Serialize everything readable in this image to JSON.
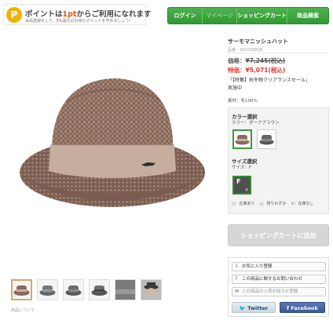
{
  "promo": {
    "badge": "P",
    "main_prefix": "ポイントは",
    "main_highlight": "1pt",
    "main_suffix": "からご利用になれます",
    "sub_prefix": "会員登録をして、",
    "sub_highlight": "5%",
    "sub_suffix": "還元のお得なポイントを貯めましょう！"
  },
  "nav": {
    "items": [
      {
        "label": "ログイン",
        "dim": false
      },
      {
        "label": "マイページ",
        "dim": true
      },
      {
        "label": "ショッピングカート",
        "dim": false
      },
      {
        "label": "商品検索",
        "dim": false
      }
    ]
  },
  "product": {
    "title": "サーモマニッシュハット",
    "code": "品番：161025818",
    "price_label": "価格：",
    "price_value": "¥7,245(税込)",
    "sale_label": "特価：",
    "sale_value": "¥5,071(税込)",
    "campaign_line1": "「【特集】秋冬物クリアランスセール」",
    "campaign_line2": "実施中",
    "material": "素材：毛100%"
  },
  "selection": {
    "color_heading": "カラー選択",
    "color_current": "カラー：ダークブラウン",
    "size_heading": "サイズ選択",
    "size_current": "サイズ：F",
    "size_option": "F",
    "size_mark": "×",
    "legend": [
      "○：在庫あり",
      "△：残りわずか",
      "×：在庫なし"
    ]
  },
  "cart_button": "ショッピングカートに追加",
  "links": {
    "favorite": "お気に入り登録",
    "inquiry": "この商品に関するお問い合わせ",
    "restock": "この商品の入荷お知らせ登録",
    "twitter": "Twitter",
    "facebook": "Facebook"
  },
  "footer_label": "商品について",
  "colors": {
    "nav_green": "#3aa33b",
    "sale_red": "#e8352b",
    "hat_brown": "#8b6a5c",
    "hat_band": "#c9b2a3"
  }
}
